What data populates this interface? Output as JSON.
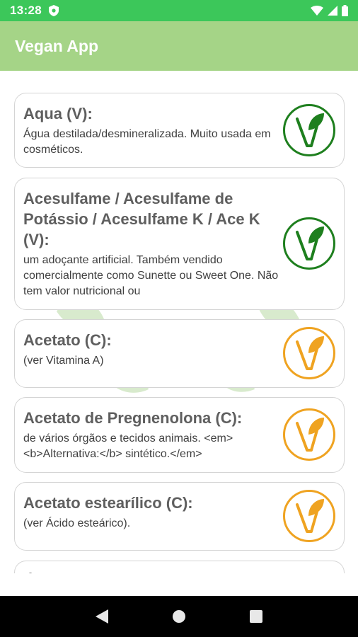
{
  "status_bar": {
    "time": "13:28",
    "color": "#3cc75a"
  },
  "app_bar": {
    "title": "Vegan App",
    "color": "#a5d487"
  },
  "items": [
    {
      "title": "Aqua (V):",
      "desc": " Água destilada/desmineralizada. Muito usada em cosméticos.",
      "status": "V",
      "icon": "vegan-leaf-icon",
      "color": "#1e7f1e"
    },
    {
      "title": "Acesulfame / Acesulfame de Potássio / Acesulfame K / Ace K (V):",
      "desc": " um adoçante artificial. Também vendido comercialmente como Sunette ou Sweet One. Não tem valor nutricional ou",
      "status": "V",
      "icon": "vegan-leaf-icon",
      "color": "#1e7f1e"
    },
    {
      "title": "Acetato (C):",
      "desc": " (ver Vitamina A)",
      "status": "C",
      "icon": "vegan-leaf-icon",
      "color": "#efa321"
    },
    {
      "title": "Acetato de Pregnenolona (C):",
      "desc": " de vários órgãos e tecidos animais. <em><b>Alternativa:</b> sintético.</em>",
      "status": "C",
      "icon": "vegan-leaf-icon",
      "color": "#efa321"
    },
    {
      "title": "Acetato estearílico (C):",
      "desc": " (ver Ácido esteárico).",
      "status": "C",
      "icon": "vegan-leaf-icon",
      "color": "#efa321"
    },
    {
      "title": "Á",
      "desc": "",
      "status": "",
      "icon": "",
      "color": "#d4d4d4"
    }
  ],
  "nav_bar": {
    "buttons": [
      "back-icon",
      "home-icon",
      "recents-icon"
    ]
  }
}
